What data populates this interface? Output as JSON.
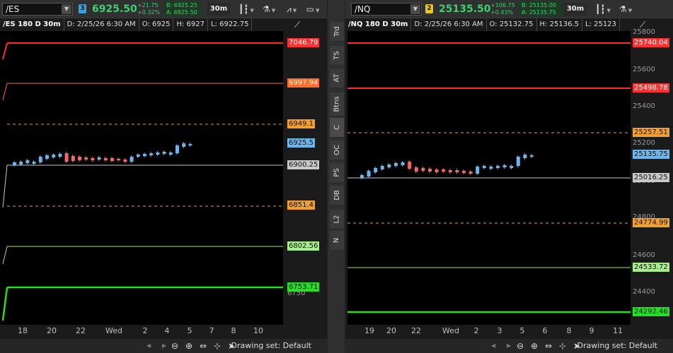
{
  "colors": {
    "up": "#6eb6ea",
    "down": "#ef6b6b",
    "green": "#3bd16f",
    "red_level": "#ff2a2a",
    "orange": "#ff6a2a",
    "dash": "#f0a030",
    "white_level": "#c8c8c8",
    "lime": "#90e86a",
    "bright_green": "#22e022"
  },
  "es": {
    "symbol": "/ES",
    "link_num": "3",
    "last": "6925.50",
    "change": "+21.75",
    "change_pct": "+0.32%",
    "bid": "B: 6925.25",
    "ask": "A: 6925.50",
    "aggregation": "30m",
    "header": {
      "title": "/ES 180 D 30m",
      "date": "D: 2/25/26 6:30 AM",
      "open": "O: 6925",
      "high": "H: 6927",
      "low": "L: 6922.75"
    },
    "levels": [
      {
        "label": "7046.79",
        "kind": "red"
      },
      {
        "label": "6997.94",
        "kind": "orange"
      },
      {
        "label": "6949.1",
        "kind": "dash"
      },
      {
        "label": "6925.5",
        "kind": "last"
      },
      {
        "label": "6900.25",
        "kind": "white"
      },
      {
        "label": "6851.4",
        "kind": "dash"
      },
      {
        "label": "6802.56",
        "kind": "lime"
      },
      {
        "label": "6753.71",
        "kind": "bright"
      }
    ],
    "hidden_label": "6750",
    "xticks": [
      "18",
      "20",
      "22",
      "Wed",
      "2",
      "4",
      "5",
      "7",
      "8",
      "10"
    ],
    "drawing_set": "Drawing set: Default"
  },
  "nq": {
    "symbol": "/NQ",
    "link_num": "2",
    "last": "25135.50",
    "change": "+106.75",
    "change_pct": "+0.43%",
    "bid": "B: 25135.00",
    "ask": "A: 25135.75",
    "aggregation": "30m",
    "header": {
      "title": "/NQ 180 D 30m",
      "date": "D: 2/25/26 6:30 AM",
      "open": "O: 25132.75",
      "high": "H: 25136.5",
      "low": "L: 25123"
    },
    "levels": [
      {
        "label": "25740.04",
        "kind": "red"
      },
      {
        "label": "25498.78",
        "kind": "red"
      },
      {
        "label": "25257.51",
        "kind": "dash"
      },
      {
        "label": "25135.75",
        "kind": "last"
      },
      {
        "label": "25016.25",
        "kind": "white"
      },
      {
        "label": "24774.99",
        "kind": "dash"
      },
      {
        "label": "24533.72",
        "kind": "lime"
      },
      {
        "label": "24292.46",
        "kind": "bright"
      }
    ],
    "axis_labels": [
      "25800",
      "25600",
      "25400",
      "25200",
      "25000",
      "24800",
      "24600",
      "24400"
    ],
    "xticks": [
      "19",
      "20",
      "22",
      "Wed",
      "2",
      "3",
      "5",
      "6",
      "8",
      "9",
      "11"
    ],
    "drawing_set": "Drawing set: Default"
  },
  "vtabs": [
    "Trd",
    "TS",
    "AT",
    "Btns",
    "C",
    "OC",
    "PS",
    "DB",
    "L2",
    "N"
  ]
}
